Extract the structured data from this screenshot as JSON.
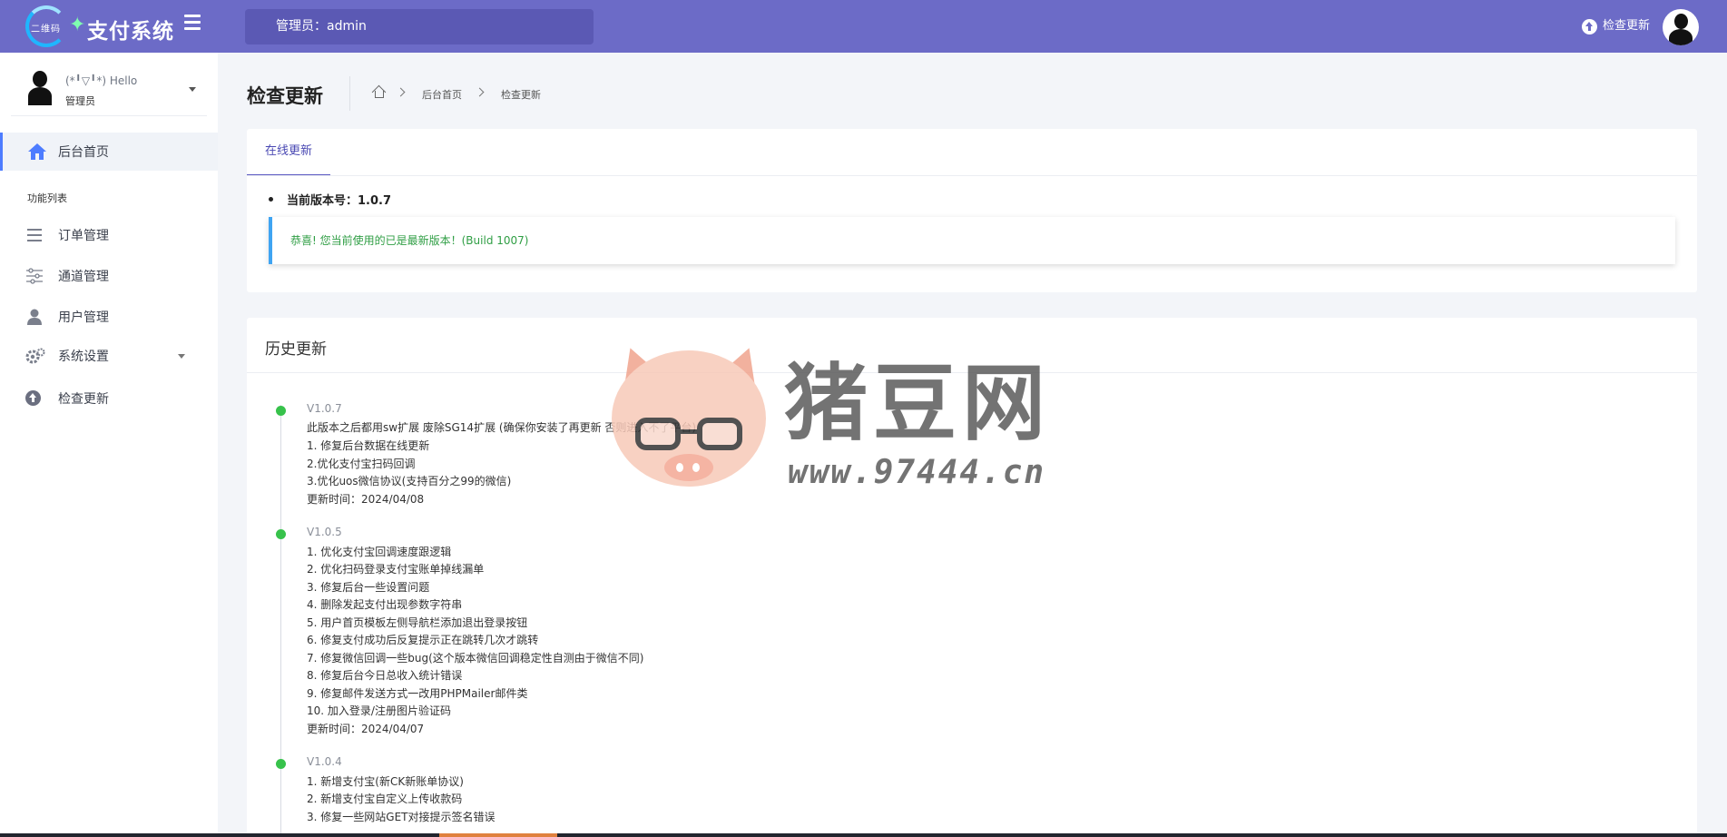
{
  "header": {
    "logo_small": "二维码",
    "logo_text": "支付系统",
    "admin_label": "管理员：admin",
    "update_label": "检查更新"
  },
  "sidebar": {
    "user_hello": "(*╹▽╹*) Hello",
    "user_role": "管理员",
    "section_title": "功能列表",
    "items": [
      {
        "label": "后台首页",
        "icon": "home-icon"
      },
      {
        "label": "订单管理",
        "icon": "list-icon"
      },
      {
        "label": "通道管理",
        "icon": "sliders-icon"
      },
      {
        "label": "用户管理",
        "icon": "user-icon"
      },
      {
        "label": "系统设置",
        "icon": "gear-icon"
      },
      {
        "label": "检查更新",
        "icon": "arrow-up-circle-icon"
      }
    ]
  },
  "page": {
    "title": "检查更新",
    "breadcrumb": [
      "后台首页",
      "检查更新"
    ]
  },
  "online_update": {
    "tab": "在线更新",
    "version_text": "当前版本号：1.0.7",
    "alert_text": "恭喜! 您当前使用的已是最新版本！(Build 1007)"
  },
  "history": {
    "title": "历史更新",
    "entries": [
      {
        "version": "V1.0.7",
        "lines": [
          "此版本之后都用sw扩展 废除SG14扩展 (确保你安装了再更新 否则进入不了平台)",
          "1. 修复后台数据在线更新",
          "2.优化支付宝扫码回调",
          "3.优化uos微信协议(支持百分之99的微信)",
          "更新时间：2024/04/08"
        ]
      },
      {
        "version": "V1.0.5",
        "lines": [
          "1. 优化支付宝回调速度跟逻辑",
          "2. 优化扫码登录支付宝账单掉线漏单",
          "3. 修复后台一些设置问题",
          "4. 删除发起支付出现参数字符串",
          "5. 用户首页模板左侧导航栏添加退出登录按钮",
          "6. 修复支付成功后反复提示正在跳转几次才跳转",
          "7. 修复微信回调一些bug(这个版本微信回调稳定性自测由于微信不同)",
          "8. 修复后台今日总收入统计错误",
          "9. 修复邮件发送方式一改用PHPMailer邮件类",
          "10. 加入登录/注册图片验证码",
          "更新时间：2024/04/07"
        ]
      },
      {
        "version": "V1.0.4",
        "lines": [
          "1. 新增支付宝(新CK新账单协议)",
          "2. 新增支付宝自定义上传收款码",
          "3. 修复一些网站GET对接提示签名错误"
        ]
      }
    ]
  },
  "watermark": {
    "title": "猪豆网",
    "url": "www.97444.cn"
  }
}
